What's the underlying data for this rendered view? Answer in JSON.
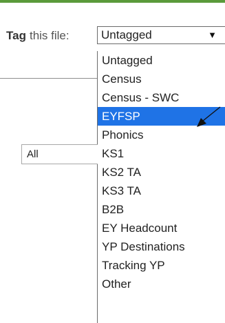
{
  "tag_file": {
    "label_bold": "Tag",
    "label_rest": "this file:",
    "selected_value": "Untagged",
    "options": [
      "Untagged",
      "Census",
      "Census - SWC",
      "EYFSP",
      "Phonics",
      "KS1",
      "KS2 TA",
      "KS3 TA",
      "B2B",
      "EY Headcount",
      "YP Destinations",
      "Tracking YP",
      "Other"
    ],
    "highlighted_option": "EYFSP"
  },
  "filter": {
    "value": "All"
  },
  "colors": {
    "accent_green": "#5a9a3b",
    "selection_blue": "#1f73e6",
    "arrow": "#111111"
  },
  "icons": {
    "dropdown_arrow": "chevron-down-icon",
    "annotation_arrow": "pointer-arrow-icon"
  }
}
